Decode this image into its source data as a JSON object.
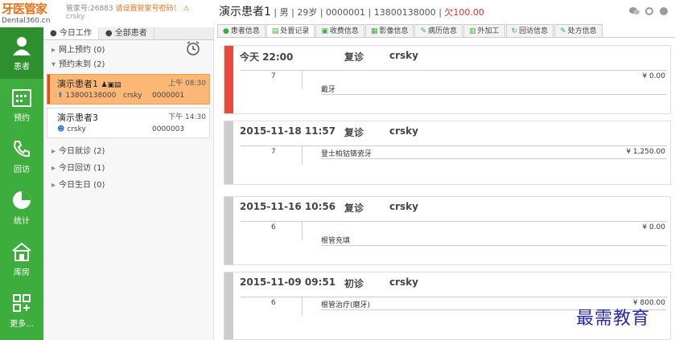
{
  "brand": {
    "name": "牙医管家",
    "url": "Dental360.cn"
  },
  "account": {
    "id_label": "管家号:26883",
    "warning": "请设置管家号密码！",
    "user": "crsky"
  },
  "nav": [
    {
      "label": "患者",
      "icon": "user-icon",
      "active": true
    },
    {
      "label": "预约",
      "icon": "calendar-icon",
      "active": false
    },
    {
      "label": "回访",
      "icon": "phone-icon",
      "active": false
    },
    {
      "label": "统计",
      "icon": "pie-chart-icon",
      "active": false
    },
    {
      "label": "库房",
      "icon": "warehouse-icon",
      "active": false
    },
    {
      "label": "更多...",
      "icon": "grid-icon",
      "active": false
    }
  ],
  "mid": {
    "tabs": [
      "今日工作",
      "全部患者"
    ],
    "groups": {
      "online": "网上预约 (0)",
      "pending": "预约未到 (2)",
      "visited": "今日就诊 (2)",
      "followup": "今日回访 (1)",
      "birthday": "今日生日 (0)"
    },
    "cards": [
      {
        "name": "演示患者1",
        "time": "上午 08:30",
        "phone": "13800138000",
        "user": "crsky",
        "code": "0000001"
      },
      {
        "name": "演示患者3",
        "time": "下午 14:30",
        "user": "crsky",
        "code": "0000003"
      }
    ]
  },
  "patient": {
    "name": "演示患者1",
    "sex": "男",
    "age": "29岁",
    "code": "0000001",
    "phone": "13800138000",
    "owe": "欠100.00"
  },
  "tabs": [
    {
      "label": "患者信息",
      "icon": "user-icon",
      "active": false
    },
    {
      "label": "处置记录",
      "icon": "record-icon",
      "active": true
    },
    {
      "label": "收费信息",
      "icon": "fee-icon",
      "active": false
    },
    {
      "label": "影像信息",
      "icon": "image-icon",
      "active": false
    },
    {
      "label": "病历信息",
      "icon": "edit-icon",
      "active": false
    },
    {
      "label": "外加工",
      "icon": "process-icon",
      "active": false
    },
    {
      "label": "回访信息",
      "icon": "followup-icon",
      "active": false
    },
    {
      "label": "处方信息",
      "icon": "prescription-icon",
      "active": false
    }
  ],
  "records": [
    {
      "date": "今天  22:00",
      "type": "复诊",
      "doctor": "crsky",
      "tooth": "7",
      "item": "戴牙",
      "price": "¥ 0.00"
    },
    {
      "date": "2015-11-18  11:57",
      "type": "复诊",
      "doctor": "crsky",
      "tooth": "7",
      "item": "登士柏钴铬瓷牙",
      "price": "¥ 1,250.00"
    },
    {
      "date": "2015-11-16  10:56",
      "type": "复诊",
      "doctor": "crsky",
      "tooth": "6",
      "item": "根管充填",
      "price": "¥ 0.00"
    },
    {
      "date": "2015-11-09  09:51",
      "type": "初诊",
      "doctor": "crsky",
      "tooth": "6",
      "item": "根管治疗(磨牙)",
      "price": "¥ 800.00"
    }
  ],
  "watermark": "最需教育"
}
